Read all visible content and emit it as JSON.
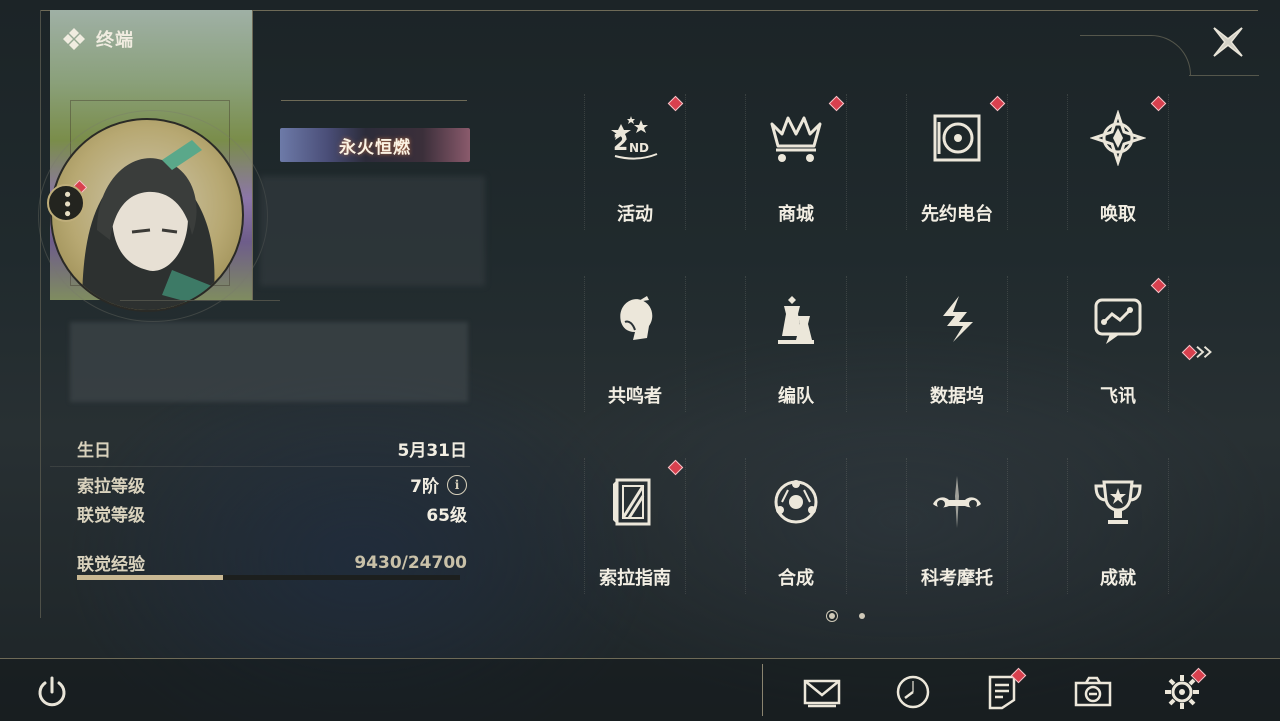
{
  "header": {
    "terminal_label": "终端"
  },
  "profile": {
    "title_badge": "永火恒燃",
    "info": [
      {
        "key": "生日",
        "value": "5月31日"
      },
      {
        "key": "索拉等级",
        "value": "7阶"
      },
      {
        "key": "联觉等级",
        "value": "65级"
      }
    ],
    "exp": {
      "label": "联觉经验",
      "current": 9430,
      "max": 24700,
      "display": "9430/24700",
      "fraction": 0.382
    }
  },
  "menu": [
    {
      "label": "活动",
      "icon": "event-2nd-anniversary-icon",
      "badge": true
    },
    {
      "label": "商城",
      "icon": "shop-cart-icon",
      "badge": true
    },
    {
      "label": "先约电台",
      "icon": "radio-turntable-icon",
      "badge": true
    },
    {
      "label": "唤取",
      "icon": "summon-compass-icon",
      "badge": true
    },
    {
      "label": "共鸣者",
      "icon": "resonator-portrait-icon",
      "badge": false
    },
    {
      "label": "编队",
      "icon": "chess-team-icon",
      "badge": false
    },
    {
      "label": "数据坞",
      "icon": "data-bank-icon",
      "badge": false
    },
    {
      "label": "飞讯",
      "icon": "chat-bubble-icon",
      "badge": true
    },
    {
      "label": "索拉指南",
      "icon": "guidebook-icon",
      "badge": true
    },
    {
      "label": "合成",
      "icon": "synthesis-icon",
      "badge": false
    },
    {
      "label": "科考摩托",
      "icon": "motorbike-icon",
      "badge": false
    },
    {
      "label": "成就",
      "icon": "trophy-icon",
      "badge": false
    }
  ],
  "pagination": {
    "pages": 2,
    "current": 1
  },
  "bottom_bar": [
    {
      "icon": "mail-icon",
      "badge": false
    },
    {
      "icon": "clock-icon",
      "badge": false
    },
    {
      "icon": "notice-icon",
      "badge": true
    },
    {
      "icon": "camera-icon",
      "badge": false
    },
    {
      "icon": "settings-gear-icon",
      "badge": true
    }
  ],
  "colors": {
    "accent_gold": "#c9b893",
    "badge_red": "#d8404e",
    "text": "#f2eee3"
  }
}
